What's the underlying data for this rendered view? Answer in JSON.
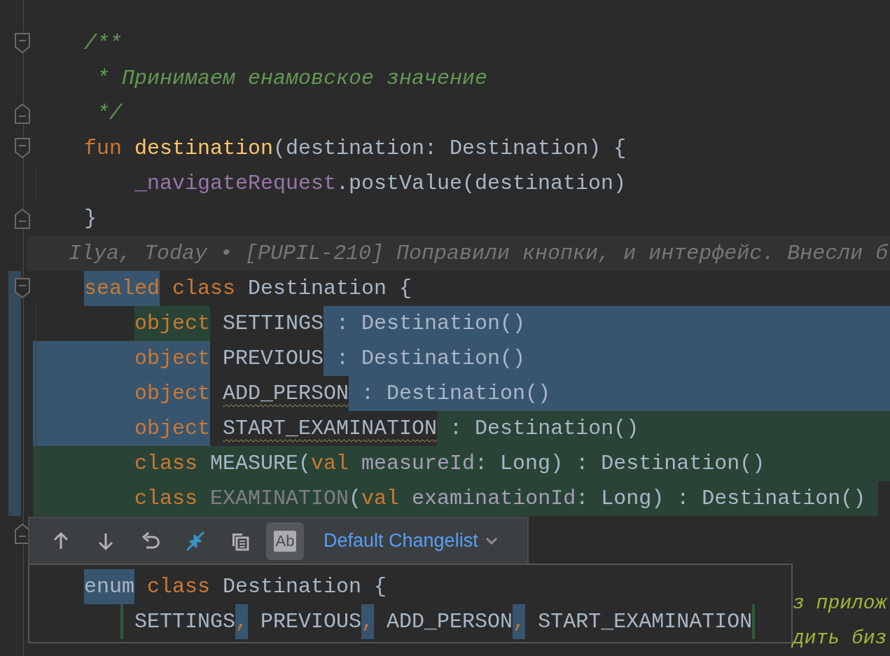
{
  "editor": {
    "lines": [
      {
        "kind": "code",
        "fold_start": true,
        "tokens": [
          {
            "text": "/**",
            "kind": "doc"
          }
        ]
      },
      {
        "kind": "code",
        "tokens": [
          {
            "text": " * Принимаем енамовское значение",
            "kind": "doc"
          }
        ]
      },
      {
        "kind": "code",
        "fold_end": true,
        "tokens": [
          {
            "text": " */",
            "kind": "doc"
          }
        ]
      },
      {
        "kind": "code",
        "fold_start": true,
        "tokens": [
          {
            "text": "fun ",
            "kind": "keyword"
          },
          {
            "text": "destination",
            "kind": "function"
          },
          {
            "text": "(destination: Destination) {",
            "kind": "plain"
          }
        ]
      },
      {
        "kind": "code",
        "indented": true,
        "tokens": [
          {
            "text": "_navigateRequest",
            "kind": "property"
          },
          {
            "text": ".postValue(destination)",
            "kind": "plain"
          }
        ]
      },
      {
        "kind": "code",
        "fold_end": true,
        "tokens": [
          {
            "text": "}",
            "kind": "plain"
          }
        ]
      },
      {
        "kind": "annotation",
        "text": "Ilya, Today • [PUPIL-210] Поправили кнопки, и интерфейс. Внесли б"
      },
      {
        "kind": "code",
        "fold_start": true,
        "modified": true,
        "tokens": [
          {
            "text": "sealed",
            "kind": "keyword",
            "changed": true
          },
          {
            "text": " class ",
            "kind": "keyword"
          },
          {
            "text": "Destination {",
            "kind": "plain"
          }
        ]
      },
      {
        "kind": "code",
        "modified": true,
        "indented": true,
        "to_edge": true,
        "tokens": [
          {
            "text": "object",
            "kind": "keyword",
            "added": true
          },
          {
            "text": " SETTINGS",
            "kind": "plain"
          },
          {
            "text": " : Destination()",
            "kind": "plain",
            "changed": true
          }
        ]
      },
      {
        "kind": "code",
        "modified": true,
        "indented": true,
        "margin_changed": true,
        "to_edge": true,
        "tokens": [
          {
            "text": "object",
            "kind": "keyword",
            "changed": true
          },
          {
            "text": " PREVIOUS",
            "kind": "plain"
          },
          {
            "text": " : Destination()",
            "kind": "plain",
            "changed": true
          }
        ]
      },
      {
        "kind": "code",
        "modified": true,
        "indented": true,
        "margin_changed": true,
        "to_edge": true,
        "tokens": [
          {
            "text": "object",
            "kind": "keyword",
            "changed": true
          },
          {
            "text": " ADD_PERSON",
            "kind": "plain",
            "warning": true
          },
          {
            "text": " : Destination()",
            "kind": "plain",
            "changed": true
          }
        ]
      },
      {
        "kind": "code",
        "modified": true,
        "indented": true,
        "margin_changed": true,
        "to_edge": true,
        "tokens": [
          {
            "text": "object",
            "kind": "keyword",
            "changed": true
          },
          {
            "text": " START_EXAMINATION",
            "kind": "plain",
            "warning": true
          },
          {
            "text": " : Destination()",
            "kind": "plain",
            "added": true
          }
        ]
      },
      {
        "kind": "code",
        "modified": true,
        "indented": true,
        "margin_added": true,
        "to_edge": true,
        "tokens": [
          {
            "text": "class ",
            "kind": "keyword",
            "added": true
          },
          {
            "text": "MEASURE(",
            "kind": "plain",
            "added": true
          },
          {
            "text": "val ",
            "kind": "keyword",
            "added": true
          },
          {
            "text": "measureId",
            "kind": "param",
            "added": true
          },
          {
            "text": ": Long) : Destination()",
            "kind": "plain",
            "added": true
          }
        ]
      },
      {
        "kind": "code",
        "modified": true,
        "indented": true,
        "margin_added": true,
        "tokens": [
          {
            "text": "class ",
            "kind": "keyword",
            "added": true
          },
          {
            "text": "EXAMINATION",
            "kind": "unused",
            "added": true
          },
          {
            "text": "(",
            "kind": "plain",
            "added": true
          },
          {
            "text": "val ",
            "kind": "keyword",
            "added": true
          },
          {
            "text": "examinationId",
            "kind": "param",
            "added": true
          },
          {
            "text": ": Long) : Destination() ",
            "kind": "plain",
            "added": true
          }
        ]
      },
      {
        "kind": "code",
        "fold_end": true
      }
    ],
    "behind_popup": [
      {
        "text": "з прилож",
        "kind": "todo"
      },
      {
        "text": "дить биз",
        "kind": "todo"
      }
    ]
  },
  "popup": {
    "toolbar": [
      {
        "kind": "up"
      },
      {
        "kind": "down"
      },
      {
        "kind": "revert"
      },
      {
        "kind": "compare"
      },
      {
        "kind": "copy"
      },
      {
        "kind": "toggle",
        "label": "Ab",
        "selected": true
      }
    ],
    "changelist": "Default Changelist",
    "lines": [
      {
        "tokens": [
          {
            "text": "enum",
            "kind": "plain",
            "changed": true
          },
          {
            "text": " class ",
            "kind": "keyword"
          },
          {
            "text": "Destination {",
            "kind": "plain"
          }
        ]
      },
      {
        "indented": true,
        "guide_added": true,
        "end_added": true,
        "tokens": [
          {
            "text": "SETTINGS",
            "kind": "plain"
          },
          {
            "text": ",",
            "kind": "keyword",
            "changed": true
          },
          {
            "text": " PREVIOUS",
            "kind": "plain"
          },
          {
            "text": ",",
            "kind": "keyword",
            "changed": true
          },
          {
            "text": " ADD_PERSON",
            "kind": "plain"
          },
          {
            "text": ",",
            "kind": "keyword",
            "changed": true
          },
          {
            "text": " START_EXAMINATION",
            "kind": "plain"
          }
        ]
      }
    ]
  }
}
